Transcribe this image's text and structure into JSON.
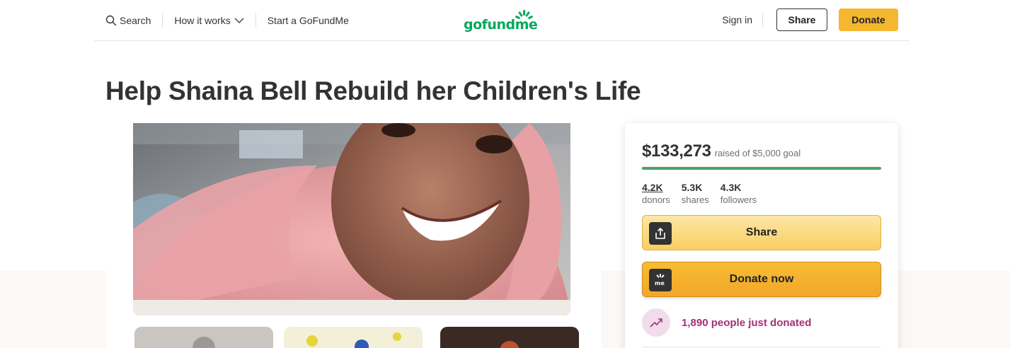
{
  "header": {
    "search_label": "Search",
    "how_it_works_label": "How it works",
    "start_label": "Start a GoFundMe",
    "logo_text": "gofundme",
    "signin_label": "Sign in",
    "share_label": "Share",
    "donate_label": "Donate"
  },
  "campaign": {
    "title": "Help Shaina Bell Rebuild her Children's Life"
  },
  "card": {
    "raised_amount": "$133,273",
    "goal_text": "raised of $5,000 goal",
    "progress_fraction": 1.0,
    "stats": [
      {
        "value": "4.2K",
        "label": "donors"
      },
      {
        "value": "5.3K",
        "label": "shares"
      },
      {
        "value": "4.3K",
        "label": "followers"
      }
    ],
    "share_button": "Share",
    "donate_button": "Donate now",
    "recent_donations": "1,890 people just donated"
  },
  "colors": {
    "brand_green": "#02a95c",
    "donate_yellow": "#f5b630",
    "progress_green": "#4f9f5f",
    "trend_purple": "#a33175"
  }
}
